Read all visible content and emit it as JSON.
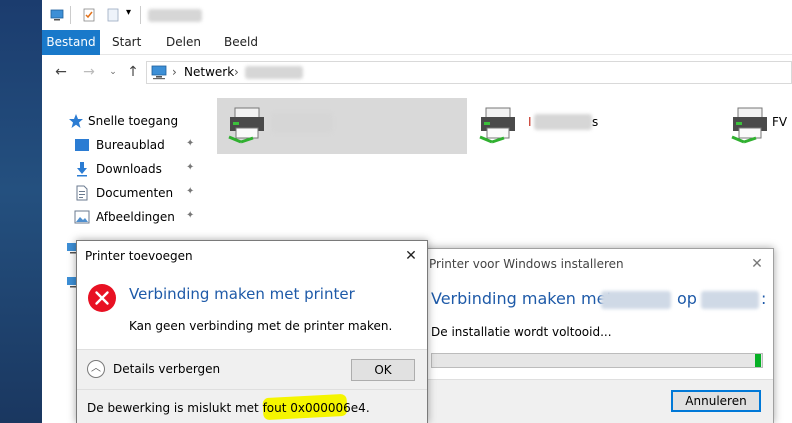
{
  "explorer": {
    "ribbon_tabs": [
      {
        "label": "Bestand",
        "active": true
      },
      {
        "label": "Start",
        "active": false
      },
      {
        "label": "Delen",
        "active": false
      },
      {
        "label": "Beeld",
        "active": false
      }
    ],
    "address": {
      "root": "Netwerk",
      "separator": "›"
    },
    "nav": {
      "quick_access": "Snelle toegang",
      "items": [
        {
          "label": "Bureaublad",
          "icon": "desktop-icon"
        },
        {
          "label": "Downloads",
          "icon": "download-icon"
        },
        {
          "label": "Documenten",
          "icon": "document-icon"
        },
        {
          "label": "Afbeeldingen",
          "icon": "pictures-icon"
        }
      ],
      "pin_glyph": "📌"
    },
    "printers": [
      {
        "label_suffix": "",
        "selected": true
      },
      {
        "label_prefix": "I",
        "label_suffix": "s",
        "selected": false
      },
      {
        "label_prefix": "FV",
        "selected": false
      }
    ]
  },
  "error_dialog": {
    "title": "Printer toevoegen",
    "heading": "Verbinding maken met printer",
    "message": "Kan geen verbinding met de printer maken.",
    "details_toggle": "Details verbergen",
    "ok_label": "OK",
    "error_detail": "De bewerking is mislukt met fout 0x000006e4.",
    "highlight_color": "#f5f500",
    "error_color": "#e81123"
  },
  "install_dialog": {
    "title": "Printer voor Windows installeren",
    "heading_prefix": "Verbinding maken met:",
    "heading_mid": "op",
    "heading_suffix": ":",
    "status": "De installatie wordt voltooid...",
    "progress": 0.99,
    "cancel_label": "Annuleren",
    "heading_color": "#1e5aa8",
    "progress_color": "#06b025"
  }
}
